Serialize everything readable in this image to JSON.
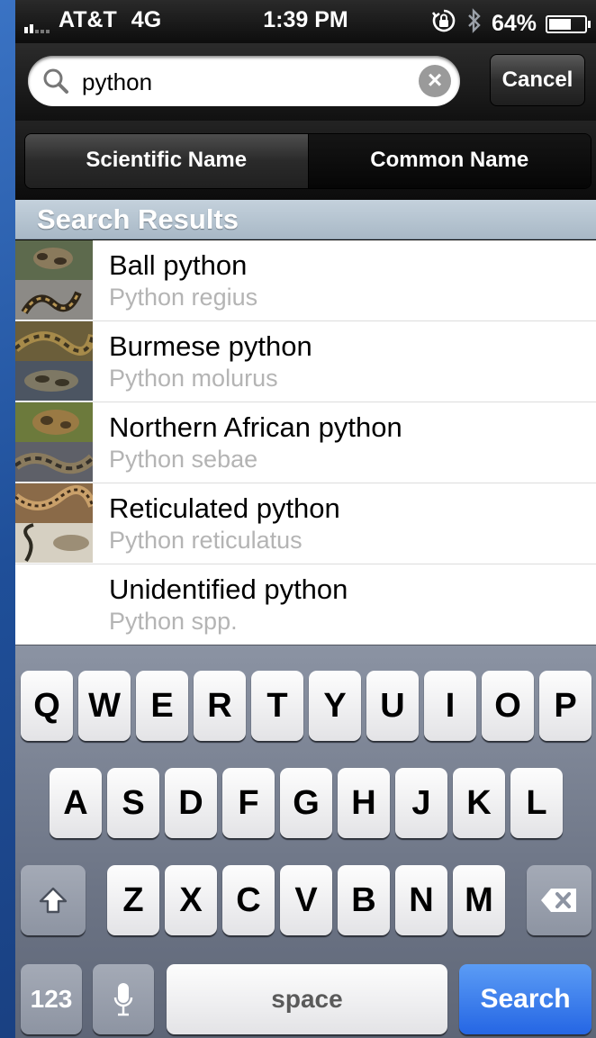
{
  "status_bar": {
    "carrier": "AT&T",
    "network": "4G",
    "time": "1:39 PM",
    "battery_percent": "64%",
    "battery_level": 0.64,
    "icons": [
      "signal-bars-icon",
      "rotation-lock-icon",
      "bluetooth-icon",
      "battery-charging-icon"
    ]
  },
  "search": {
    "value": "python",
    "placeholder": "",
    "cancel_label": "Cancel",
    "clear_icon": "clear-icon",
    "search_icon": "search-icon"
  },
  "segments": {
    "items": [
      {
        "label": "Scientific Name",
        "selected": true
      },
      {
        "label": "Common Name",
        "selected": false
      }
    ]
  },
  "results": {
    "header": "Search Results",
    "items": [
      {
        "common": "Ball python",
        "scientific": "Python regius",
        "has_thumbnail": true
      },
      {
        "common": "Burmese python",
        "scientific": "Python molurus",
        "has_thumbnail": true
      },
      {
        "common": "Northern African python",
        "scientific": "Python sebae",
        "has_thumbnail": true
      },
      {
        "common": "Reticulated python",
        "scientific": "Python reticulatus",
        "has_thumbnail": true
      },
      {
        "common": "Unidentified python",
        "scientific": "Python spp.",
        "has_thumbnail": false
      }
    ]
  },
  "keyboard": {
    "row1": [
      "Q",
      "W",
      "E",
      "R",
      "T",
      "Y",
      "U",
      "I",
      "O",
      "P"
    ],
    "row2": [
      "A",
      "S",
      "D",
      "F",
      "G",
      "H",
      "J",
      "K",
      "L"
    ],
    "row3": [
      "Z",
      "X",
      "C",
      "V",
      "B",
      "N",
      "M"
    ],
    "numbers_label": "123",
    "space_label": "space",
    "search_label": "Search",
    "shift_icon": "shift-icon",
    "delete_icon": "delete-icon",
    "mic_icon": "microphone-icon"
  },
  "colors": {
    "search_key": "#2566e4",
    "section_header": "#b6c4d0",
    "subtitle_text": "#b4b4b4"
  }
}
